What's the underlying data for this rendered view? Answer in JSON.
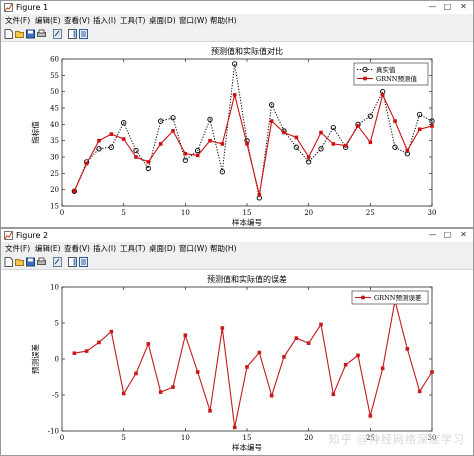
{
  "colors": {
    "pred_red": "#cc1111",
    "err_red": "#c61a1a",
    "actual_black": "#000000",
    "window_bg": "#f0f0f0"
  },
  "icons": {
    "window": "matlab-figure-icon",
    "minimize": "minimize-icon",
    "maximize": "maximize-icon",
    "close": "close-icon"
  },
  "window1": {
    "title": "Figure 1",
    "menu": [
      "文件(F)",
      "编辑(E)",
      "查看(V)",
      "插入(I)",
      "工具(T)",
      "桌面(D)",
      "窗口(W)",
      "帮助(H)"
    ]
  },
  "window2": {
    "title": "Figure 2",
    "menu": [
      "文件(F)",
      "编辑(E)",
      "查看(V)",
      "插入(I)",
      "工具(T)",
      "桌面(D)",
      "窗口(W)",
      "帮助(H)"
    ]
  },
  "watermark": "知乎 @神经网络深度学习",
  "chart_data": [
    {
      "type": "line",
      "title": "预测值和实际值对比",
      "xlabel": "样本编号",
      "ylabel": "指标值",
      "xlim": [
        0,
        30
      ],
      "ylim": [
        15,
        60
      ],
      "xticks": [
        0,
        5,
        10,
        15,
        20,
        25,
        30
      ],
      "yticks": [
        15,
        20,
        25,
        30,
        35,
        40,
        45,
        50,
        55,
        60
      ],
      "grid": false,
      "legend_position": "top-right",
      "x": [
        1,
        2,
        3,
        4,
        5,
        6,
        7,
        8,
        9,
        10,
        11,
        12,
        13,
        14,
        15,
        16,
        17,
        18,
        19,
        20,
        21,
        22,
        23,
        24,
        25,
        26,
        27,
        28,
        29,
        30
      ],
      "series": [
        {
          "name": "真实值",
          "color": "#000000",
          "style": "dotted-circle",
          "values": [
            19.5,
            28.5,
            32.5,
            33,
            40.5,
            32,
            26.5,
            41,
            42,
            29,
            32,
            41.5,
            25.5,
            58.5,
            35,
            17.5,
            46,
            38,
            33,
            28.5,
            32.5,
            39,
            33,
            40,
            42.5,
            50,
            33,
            31,
            43,
            41
          ]
        },
        {
          "name": "GRNN预测值",
          "color": "#cc1111",
          "style": "solid-square",
          "values": [
            19.5,
            28,
            35,
            37,
            35.5,
            30,
            28.5,
            34,
            38,
            31,
            30.5,
            35,
            34,
            49,
            34,
            18.5,
            41,
            37.5,
            36,
            30,
            37.5,
            34,
            33.5,
            39.5,
            34.5,
            49,
            41,
            32,
            38.5,
            39.5
          ]
        }
      ]
    },
    {
      "type": "line",
      "title": "预测值和实际值的误差",
      "xlabel": "样本编号",
      "ylabel": "预测误差",
      "xlim": [
        0,
        30
      ],
      "ylim": [
        -10,
        10
      ],
      "xticks": [
        0,
        5,
        10,
        15,
        20,
        25,
        30
      ],
      "yticks": [
        -10,
        -5,
        0,
        5,
        10
      ],
      "grid": false,
      "legend_position": "top-right",
      "x": [
        1,
        2,
        3,
        4,
        5,
        6,
        7,
        8,
        9,
        10,
        11,
        12,
        13,
        14,
        15,
        16,
        17,
        18,
        19,
        20,
        21,
        22,
        23,
        24,
        25,
        26,
        27,
        28,
        29,
        30
      ],
      "series": [
        {
          "name": "GRNN预测误差",
          "color": "#c61a1a",
          "style": "solid-square",
          "values": [
            0.8,
            1.1,
            2.3,
            3.8,
            -4.8,
            -2,
            2.1,
            -4.6,
            -3.9,
            3.3,
            -1.8,
            -7.2,
            4.3,
            -9.5,
            -1.1,
            0.9,
            -5.1,
            0.3,
            2.9,
            2.2,
            4.8,
            -4.9,
            -0.8,
            0.5,
            -7.9,
            -1.3,
            8.1,
            1.4,
            -4.5,
            -1.8
          ]
        }
      ]
    }
  ]
}
